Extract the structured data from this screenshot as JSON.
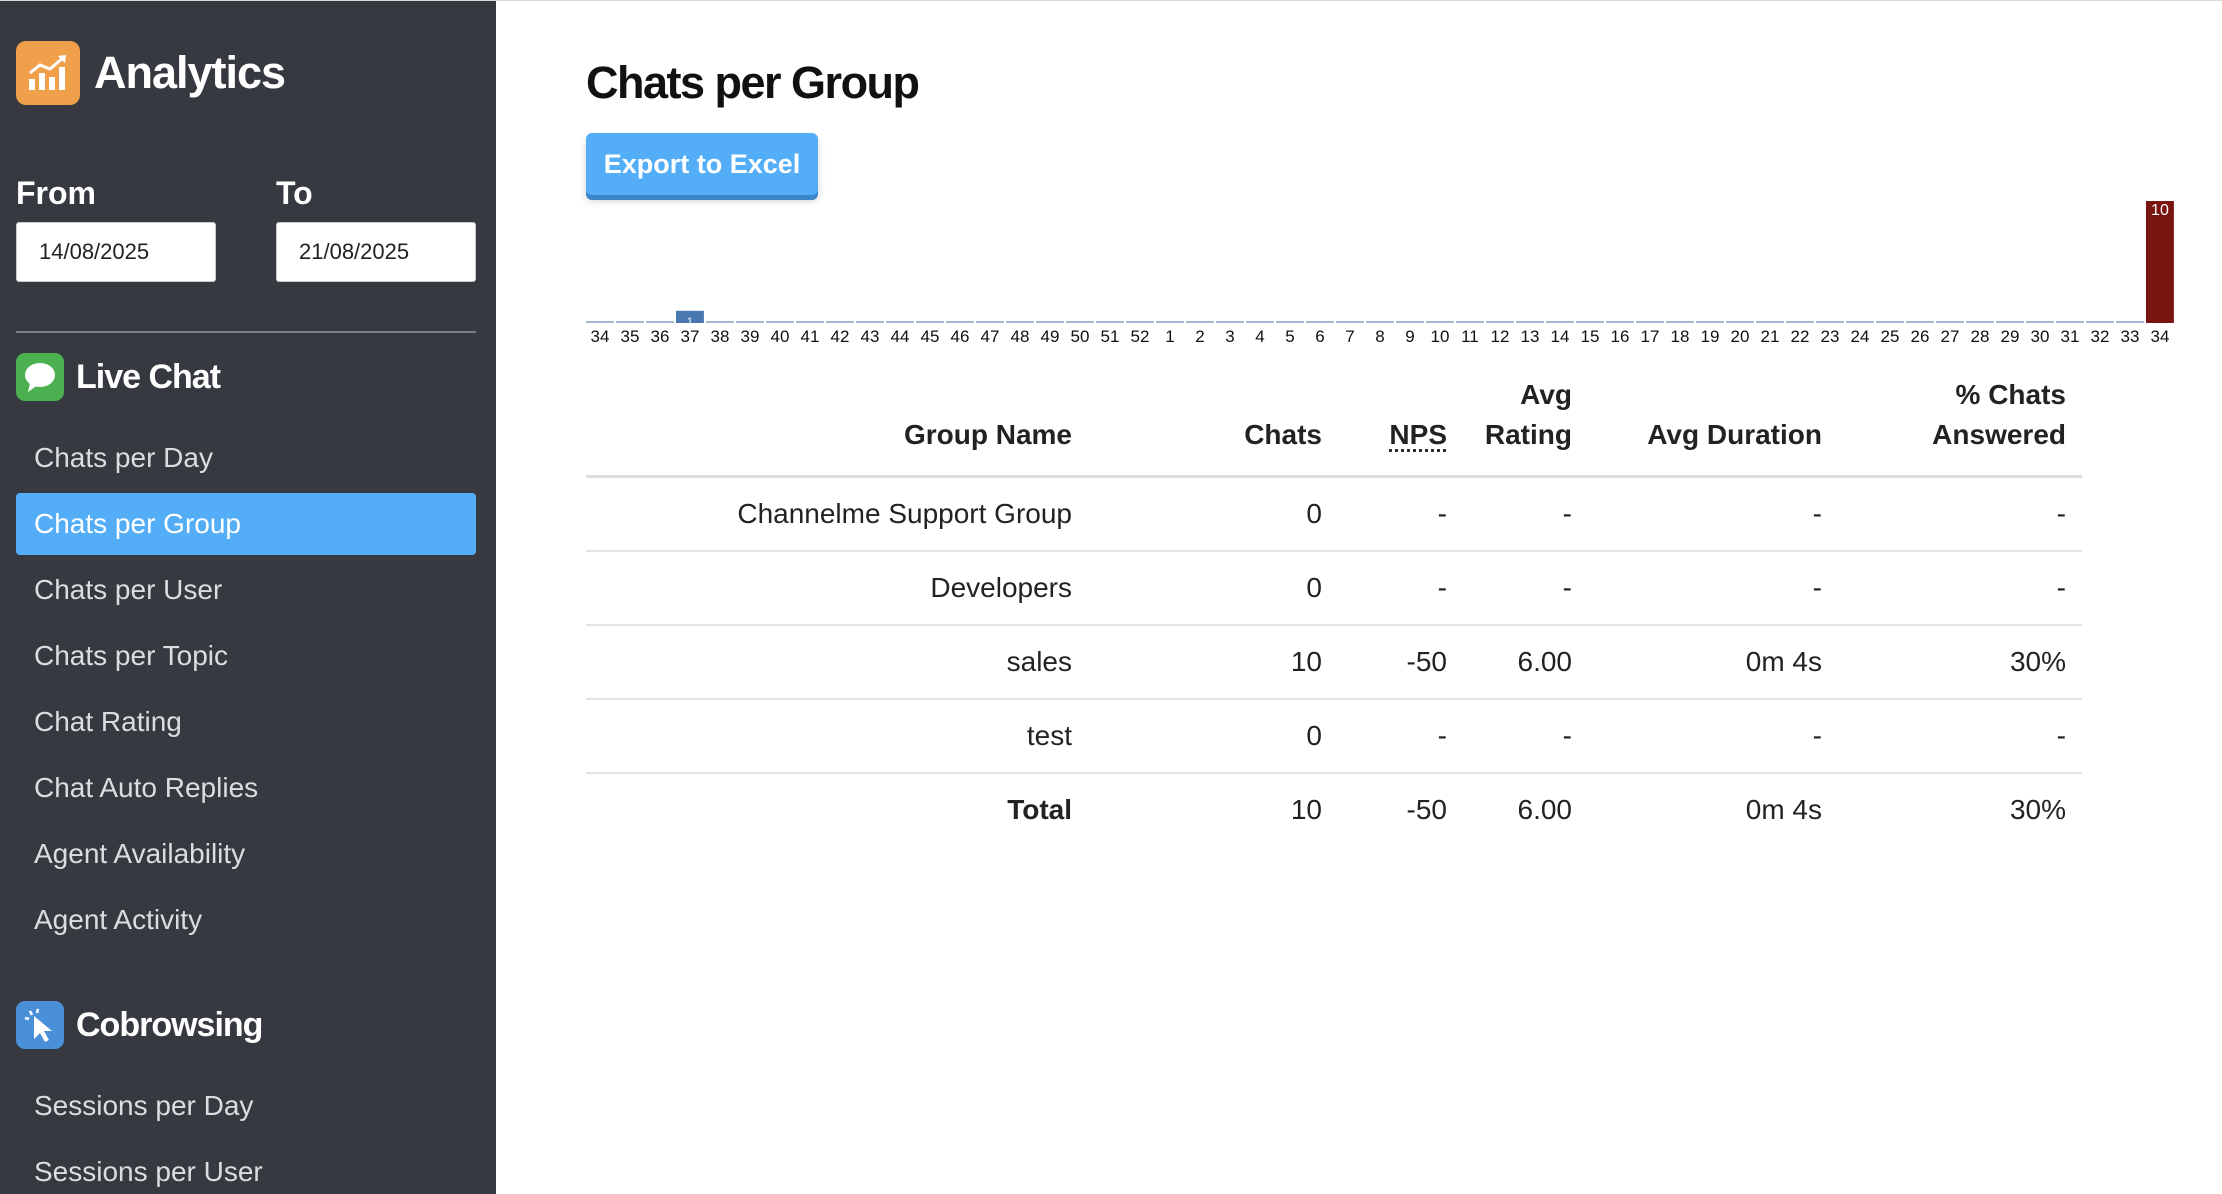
{
  "sidebar": {
    "title": "Analytics",
    "from_label": "From",
    "from_value": "14/08/2025",
    "to_label": "To",
    "to_value": "21/08/2025",
    "live_chat": {
      "title": "Live Chat",
      "items": [
        "Chats per Day",
        "Chats per Group",
        "Chats per User",
        "Chats per Topic",
        "Chat Rating",
        "Chat Auto Replies",
        "Agent Availability",
        "Agent Activity"
      ],
      "active": "Chats per Group"
    },
    "cobrowsing": {
      "title": "Cobrowsing",
      "items": [
        "Sessions per Day",
        "Sessions per User"
      ]
    }
  },
  "main": {
    "title": "Chats per Group",
    "export_label": "Export to Excel"
  },
  "chart_data": {
    "type": "bar",
    "categories": [
      "34",
      "35",
      "36",
      "37",
      "38",
      "39",
      "40",
      "41",
      "42",
      "43",
      "44",
      "45",
      "46",
      "47",
      "48",
      "49",
      "50",
      "51",
      "52",
      "1",
      "2",
      "3",
      "4",
      "5",
      "6",
      "7",
      "8",
      "9",
      "10",
      "11",
      "12",
      "13",
      "14",
      "15",
      "16",
      "17",
      "18",
      "19",
      "20",
      "21",
      "22",
      "23",
      "24",
      "25",
      "26",
      "27",
      "28",
      "29",
      "30",
      "31",
      "32",
      "33",
      "34"
    ],
    "values": [
      0,
      0,
      0,
      1,
      0,
      0,
      0,
      0,
      0,
      0,
      0,
      0,
      0,
      0,
      0,
      0,
      0,
      0,
      0,
      0,
      0,
      0,
      0,
      0,
      0,
      0,
      0,
      0,
      0,
      0,
      0,
      0,
      0,
      0,
      0,
      0,
      0,
      0,
      0,
      0,
      0,
      0,
      0,
      0,
      0,
      0,
      0,
      0,
      0,
      0,
      0,
      0,
      10
    ],
    "value_labels": {
      "3": "1",
      "52": "10"
    },
    "highlight_index": 52,
    "colors": {
      "default": "#4a78b0",
      "highlight": "#7a1410",
      "zero": "#9fb6d4"
    },
    "ylim": [
      0,
      10
    ],
    "grid": false,
    "title": "",
    "xlabel": "",
    "ylabel": ""
  },
  "table": {
    "headers": [
      {
        "line1": "",
        "line2": "Group Name"
      },
      {
        "line1": "",
        "line2": "Chats"
      },
      {
        "line1": "",
        "line2": "NPS"
      },
      {
        "line1": "Avg",
        "line2": "Rating"
      },
      {
        "line1": "",
        "line2": "Avg Duration"
      },
      {
        "line1": "% Chats",
        "line2": "Answered"
      }
    ],
    "rows": [
      [
        "Channelme Support Group",
        "0",
        "-",
        "-",
        "-",
        "-"
      ],
      [
        "Developers",
        "0",
        "-",
        "-",
        "-",
        "-"
      ],
      [
        "sales",
        "10",
        "-50",
        "6.00",
        "0m 4s",
        "30%"
      ],
      [
        "test",
        "0",
        "-",
        "-",
        "-",
        "-"
      ]
    ],
    "total": [
      "Total",
      "10",
      "-50",
      "6.00",
      "0m 4s",
      "30%"
    ]
  }
}
